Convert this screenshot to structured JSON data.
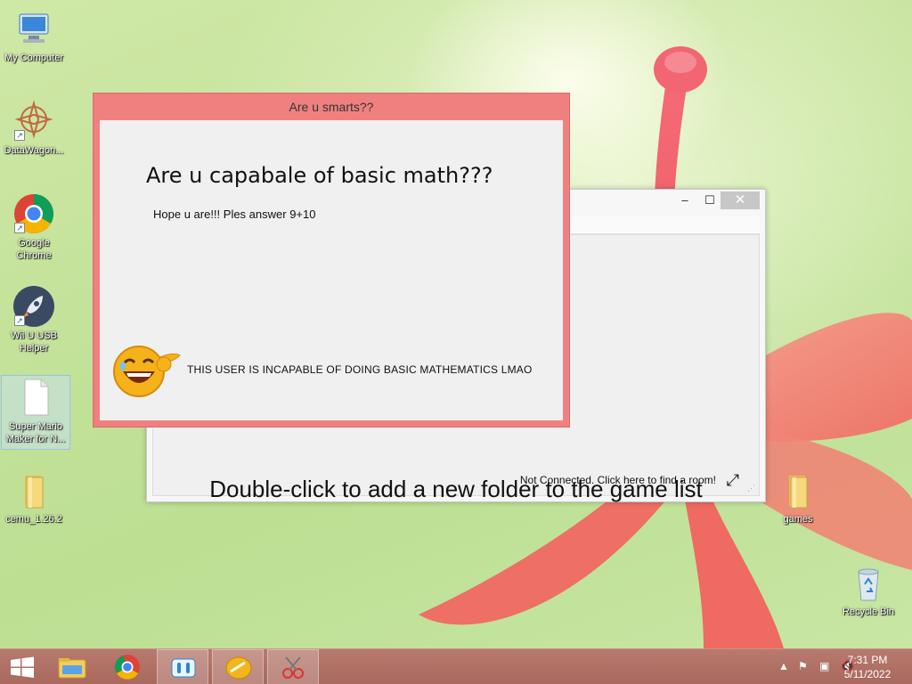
{
  "desktop": {
    "icons": [
      {
        "label": "My Computer",
        "icon": "computer-icon"
      },
      {
        "label": "DataWagon...",
        "icon": "datawagon-icon"
      },
      {
        "label": "Google Chrome",
        "icon": "chrome-icon"
      },
      {
        "label": "Wii U USB Helper",
        "icon": "rocket-icon"
      },
      {
        "label": "Super Mario Maker for N...",
        "icon": "file-icon"
      },
      {
        "label": "cemu_1.26.2",
        "icon": "folder-icon"
      },
      {
        "label": "games",
        "icon": "folder-icon"
      },
      {
        "label": "Recycle Bin",
        "icon": "recycle-bin-icon"
      }
    ]
  },
  "bg_window": {
    "minimize": "–",
    "maximize": "☐",
    "close": "✕",
    "game_list_hint": "Double-click to add a new folder to the game list",
    "status_text": "Not Connected. Click here to find a room!"
  },
  "dialog": {
    "title": "Are u smarts??",
    "heading": "Are u capabale of basic math???",
    "subtext": "Hope u are!!! Ples answer 9+10",
    "message": "THIS USER IS INCAPABLE OF DOING BASIC MATHEMATICS LMAO"
  },
  "taskbar": {
    "buttons": [
      "start-button",
      "file-explorer",
      "chrome",
      "wii-u-usb-helper",
      "cemu",
      "snipping-tool"
    ],
    "clock_time": "7:31 PM",
    "clock_date": "5/11/2022"
  },
  "colors": {
    "dialog_accent": "#f08080",
    "taskbar": "#b07366"
  }
}
